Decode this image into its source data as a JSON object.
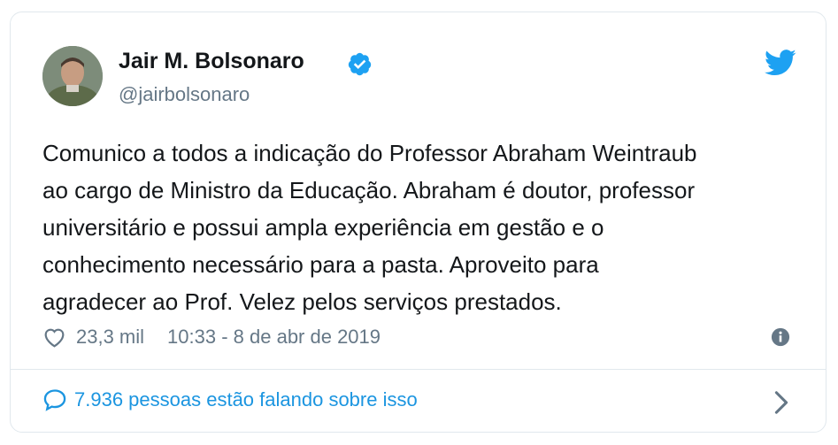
{
  "user": {
    "display_name": "Jair M. Bolsonaro",
    "handle": "@jairbolsonaro",
    "verified": true,
    "avatar_icon": "profile-photo"
  },
  "brand_icon": "twitter-bird-icon",
  "tweet": {
    "lines": [
      "Comunico a todos a indicação do Professor Abraham Weintraub",
      "ao cargo de Ministro da Educação. Abraham é doutor, professor",
      "universitário e possui ampla experiência em gestão e o",
      "conhecimento necessário para a pasta. Aproveito para",
      "agradecer ao Prof. Velez pelos serviços prestados."
    ]
  },
  "meta": {
    "likes": "23,3 mil",
    "timestamp": "10:33 - 8 de abr de 2019"
  },
  "conversation": {
    "label": "7.936 pessoas estão falando sobre isso"
  },
  "colors": {
    "accent": "#1da1f2",
    "link": "#1b95e0",
    "text": "#14171a",
    "muted": "#657786",
    "border": "#e1e8ed"
  }
}
